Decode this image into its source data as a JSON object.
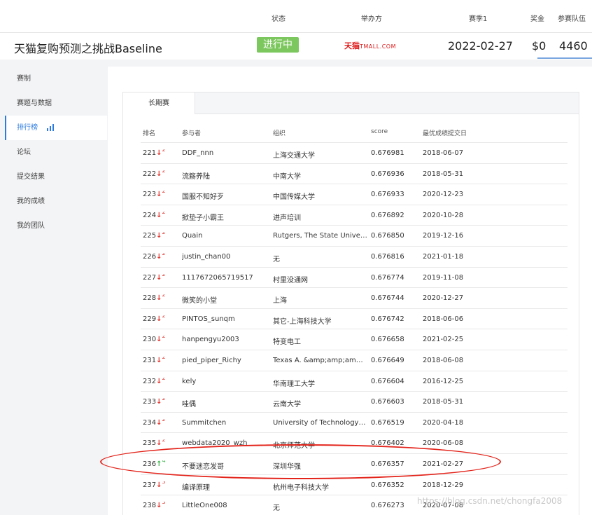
{
  "header": {
    "columns": {
      "status": "状态",
      "organizer": "举办方",
      "season": "赛季1",
      "prize": "奖金",
      "teams": "参赛队伍"
    },
    "title": "天猫复购预测之挑战Baseline",
    "status_badge": "进行中",
    "organizer_logo_cn": "天猫",
    "organizer_logo_en": "TMALL.COM",
    "date": "2022-02-27",
    "prize": "$0",
    "teams": "4460"
  },
  "sidebar": {
    "items": [
      {
        "label": "赛制"
      },
      {
        "label": "赛题与数据"
      },
      {
        "label": "排行榜"
      },
      {
        "label": "论坛"
      },
      {
        "label": "提交结果"
      },
      {
        "label": "我的成绩"
      },
      {
        "label": "我的团队"
      }
    ],
    "active": "排行榜"
  },
  "tabs": [
    {
      "label": "长期赛"
    }
  ],
  "table": {
    "headers": {
      "rank": "排名",
      "participant": "参与者",
      "org": "组织",
      "score": "score",
      "date": "最优成绩提交日"
    },
    "rows": [
      {
        "rank": "221",
        "dir": "down",
        "chg": "2",
        "name": "DDF_nnn",
        "org": "上海交通大学",
        "score": "0.676981",
        "date": "2018-06-07"
      },
      {
        "rank": "222",
        "dir": "down",
        "chg": "2",
        "name": "流觞养陆",
        "org": "中南大学",
        "score": "0.676936",
        "date": "2018-05-31"
      },
      {
        "rank": "223",
        "dir": "down",
        "chg": "2",
        "name": "国服不知好歹",
        "org": "中国传媒大学",
        "score": "0.676933",
        "date": "2020-12-23"
      },
      {
        "rank": "224",
        "dir": "down",
        "chg": "2",
        "name": "掀垫子小霸王",
        "org": "进声培训",
        "score": "0.676892",
        "date": "2020-10-28"
      },
      {
        "rank": "225",
        "dir": "down",
        "chg": "2",
        "name": "Quain",
        "org": "Rutgers, The State Universi...",
        "score": "0.676850",
        "date": "2019-12-16"
      },
      {
        "rank": "226",
        "dir": "down",
        "chg": "2",
        "name": "justin_chan00",
        "org": "无",
        "score": "0.676816",
        "date": "2021-01-18"
      },
      {
        "rank": "227",
        "dir": "down",
        "chg": "2",
        "name": "1117672065719517",
        "org": "村里没通网",
        "score": "0.676774",
        "date": "2019-11-08"
      },
      {
        "rank": "228",
        "dir": "down",
        "chg": "2",
        "name": "微笑的小堂",
        "org": "上海",
        "score": "0.676744",
        "date": "2020-12-27"
      },
      {
        "rank": "229",
        "dir": "down",
        "chg": "2",
        "name": "PINTOS_sunqm",
        "org": "其它-上海科技大学",
        "score": "0.676742",
        "date": "2018-06-06"
      },
      {
        "rank": "230",
        "dir": "down",
        "chg": "2",
        "name": "hanpengyu2003",
        "org": "特变电工",
        "score": "0.676658",
        "date": "2021-02-25"
      },
      {
        "rank": "231",
        "dir": "down",
        "chg": "2",
        "name": "pied_piper_Richy",
        "org": "Texas A. &amp;amp;amp; ...",
        "score": "0.676649",
        "date": "2018-06-08"
      },
      {
        "rank": "232",
        "dir": "down",
        "chg": "2",
        "name": "kely",
        "org": "华南理工大学",
        "score": "0.676604",
        "date": "2016-12-25"
      },
      {
        "rank": "233",
        "dir": "down",
        "chg": "2",
        "name": "哇偶",
        "org": "云南大学",
        "score": "0.676603",
        "date": "2018-05-31"
      },
      {
        "rank": "234",
        "dir": "down",
        "chg": "2",
        "name": "Summitchen",
        "org": "University of Technology, S...",
        "score": "0.676519",
        "date": "2020-04-18"
      },
      {
        "rank": "235",
        "dir": "down",
        "chg": "2",
        "name": "webdata2020_wzh",
        "org": "北京师范大学",
        "score": "0.676402",
        "date": "2020-06-08"
      },
      {
        "rank": "236",
        "dir": "up",
        "chg": "4",
        "name": "不要迷恋发哥",
        "org": "深圳华强",
        "score": "0.676357",
        "date": "2021-02-27"
      },
      {
        "rank": "237",
        "dir": "down",
        "chg": "3",
        "name": "编译原理",
        "org": "杭州电子科技大学",
        "score": "0.676352",
        "date": "2018-12-29"
      },
      {
        "rank": "238",
        "dir": "down",
        "chg": "3",
        "name": "LittleOne008",
        "org": "无",
        "score": "0.676273",
        "date": "2020-07-08"
      }
    ]
  },
  "watermark": "https://blog.csdn.net/chongfa2008",
  "colors": {
    "accent": "#2d7be0",
    "status_green": "#7cc75e",
    "down_red": "#e0332c",
    "up_green": "#3bb54a",
    "annotation_red": "#e3241b"
  }
}
